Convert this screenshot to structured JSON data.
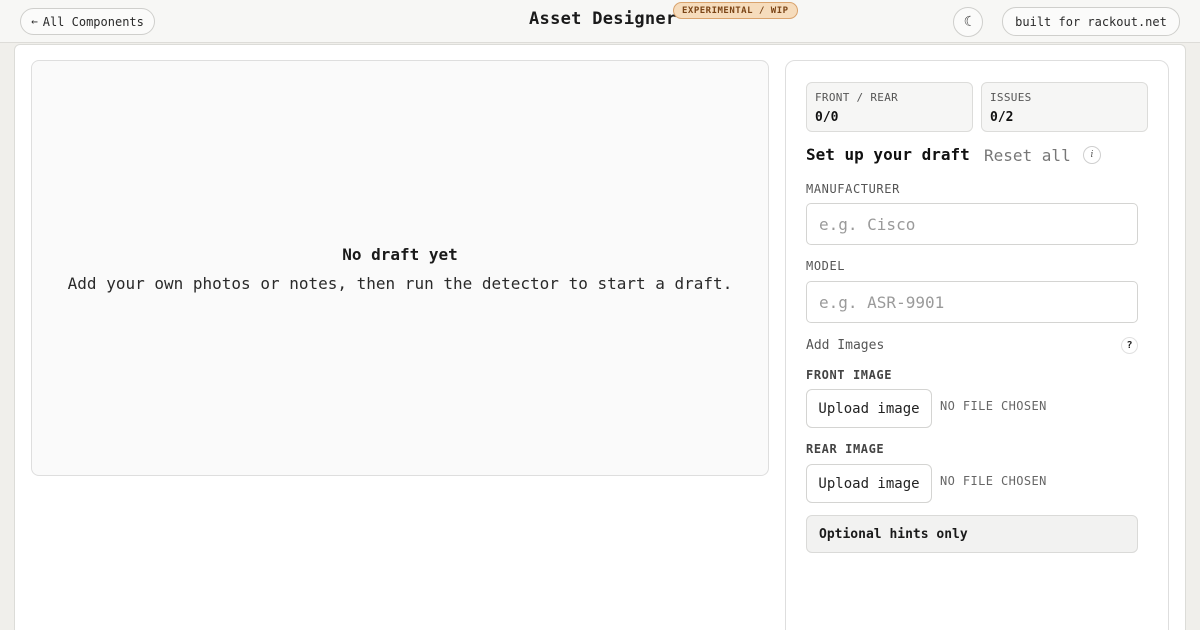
{
  "header": {
    "back_label": "All Components",
    "back_arrow": "←",
    "title": "Asset Designer",
    "badge": "EXPERIMENTAL / WIP",
    "theme_icon": "☾",
    "built_for": "built for rackout.net"
  },
  "canvas": {
    "empty_title": "No draft yet",
    "empty_desc": "Add your own photos or notes, then run the detector to start a draft."
  },
  "sidebar": {
    "stats": {
      "front_rear": {
        "label": "FRONT / REAR",
        "value": "0/0"
      },
      "issues": {
        "label": "ISSUES",
        "value": "0/2"
      }
    },
    "setup_title": "Set up your draft",
    "reset_label": "Reset all",
    "info_glyph": "i",
    "manufacturer": {
      "label": "MANUFACTURER",
      "placeholder": "e.g. Cisco",
      "value": ""
    },
    "model": {
      "label": "MODEL",
      "placeholder": "e.g. ASR-9901",
      "value": ""
    },
    "add_images_label": "Add Images",
    "help_glyph": "?",
    "front_image": {
      "label": "FRONT IMAGE",
      "button": "Upload image",
      "status": "NO FILE CHOSEN"
    },
    "rear_image": {
      "label": "REAR IMAGE",
      "button": "Upload image",
      "status": "NO FILE CHOSEN"
    },
    "hints_label": "Optional hints only"
  },
  "colors": {
    "badge_bg": "#f6dcbc",
    "badge_text": "#7a4416",
    "page_bg": "#f0efeb"
  }
}
